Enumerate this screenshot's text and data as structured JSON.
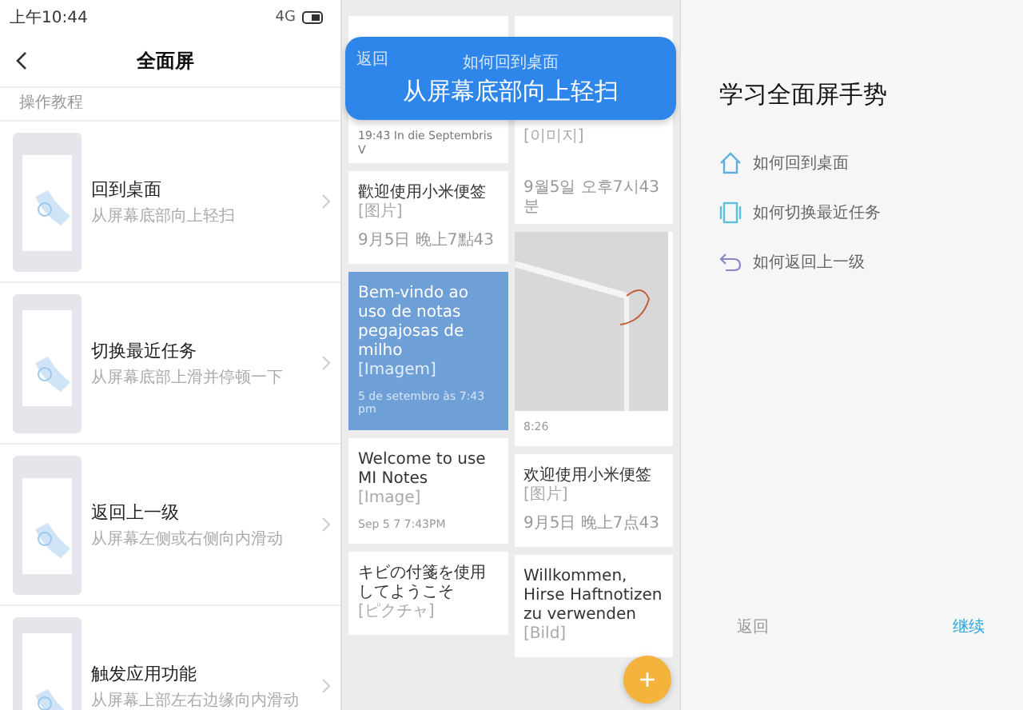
{
  "settings": {
    "status_bar": {
      "time": "上午10:44",
      "network": "4G"
    },
    "title": "全面屏",
    "section_label": "操作教程",
    "items": [
      {
        "title": "回到桌面",
        "subtitle": "从屏幕底部向上轻扫"
      },
      {
        "title": "切换最近任务",
        "subtitle": "从屏幕底部上滑并停顿一下"
      },
      {
        "title": "返回上一级",
        "subtitle": "从屏幕左侧或右侧向内滑动"
      },
      {
        "title": "触发应用功能",
        "subtitle": "从屏幕上部左右边缘向内滑动"
      }
    ]
  },
  "notes": {
    "toast": {
      "back": "返回",
      "caption": "如何回到桌面",
      "instruction": "从屏幕底部向上轻扫"
    },
    "columns": [
      [
        {
          "kind": "text",
          "color": "#ffffff",
          "date": "19:43 In die Septembris V"
        },
        {
          "kind": "text",
          "color": "#ffffff",
          "lines": [
            "歡迎使用小米便签"
          ],
          "tag": "[图片]",
          "date": "9月5日 晚上7點43"
        },
        {
          "kind": "text",
          "color": "#6e9fd6",
          "lines": [
            "Bem-vindo ao uso de notas pegajosas de milho"
          ],
          "tag": "[Imagem]",
          "date": "5 de setembro às 7:43 pm"
        },
        {
          "kind": "text",
          "color": "#ffffff",
          "lines": [
            "Welcome to use MI Notes"
          ],
          "tag": "[Image]",
          "date": "Sep 5 7 7:43PM"
        },
        {
          "kind": "text",
          "color": "#ffffff",
          "lines": [
            "キビの付箋を使用してようこそ"
          ],
          "tag": "[ピクチャ]"
        }
      ],
      [
        {
          "kind": "text",
          "color": "#ffffff",
          "tag": "[이미지]",
          "date": "9월5일 오후7시43분"
        },
        {
          "kind": "image",
          "color": "#ffffff",
          "date": "8:26"
        },
        {
          "kind": "text",
          "color": "#ffffff",
          "lines": [
            "欢迎使用小米便签"
          ],
          "tag": "[图片]",
          "date": "9月5日 晚上7点43"
        },
        {
          "kind": "text",
          "color": "#ffffff",
          "lines": [
            "Willkommen, Hirse Haftnotizen zu verwenden"
          ],
          "tag": "[Bild]"
        }
      ]
    ],
    "fab": "+"
  },
  "guide": {
    "title": "学习全面屏手势",
    "items": [
      {
        "kind": "home",
        "label": "如何回到桌面"
      },
      {
        "kind": "recents",
        "label": "如何切换最近任务"
      },
      {
        "kind": "back",
        "label": "如何返回上一级"
      }
    ],
    "back_button": "返回",
    "continue_button": "继续"
  }
}
